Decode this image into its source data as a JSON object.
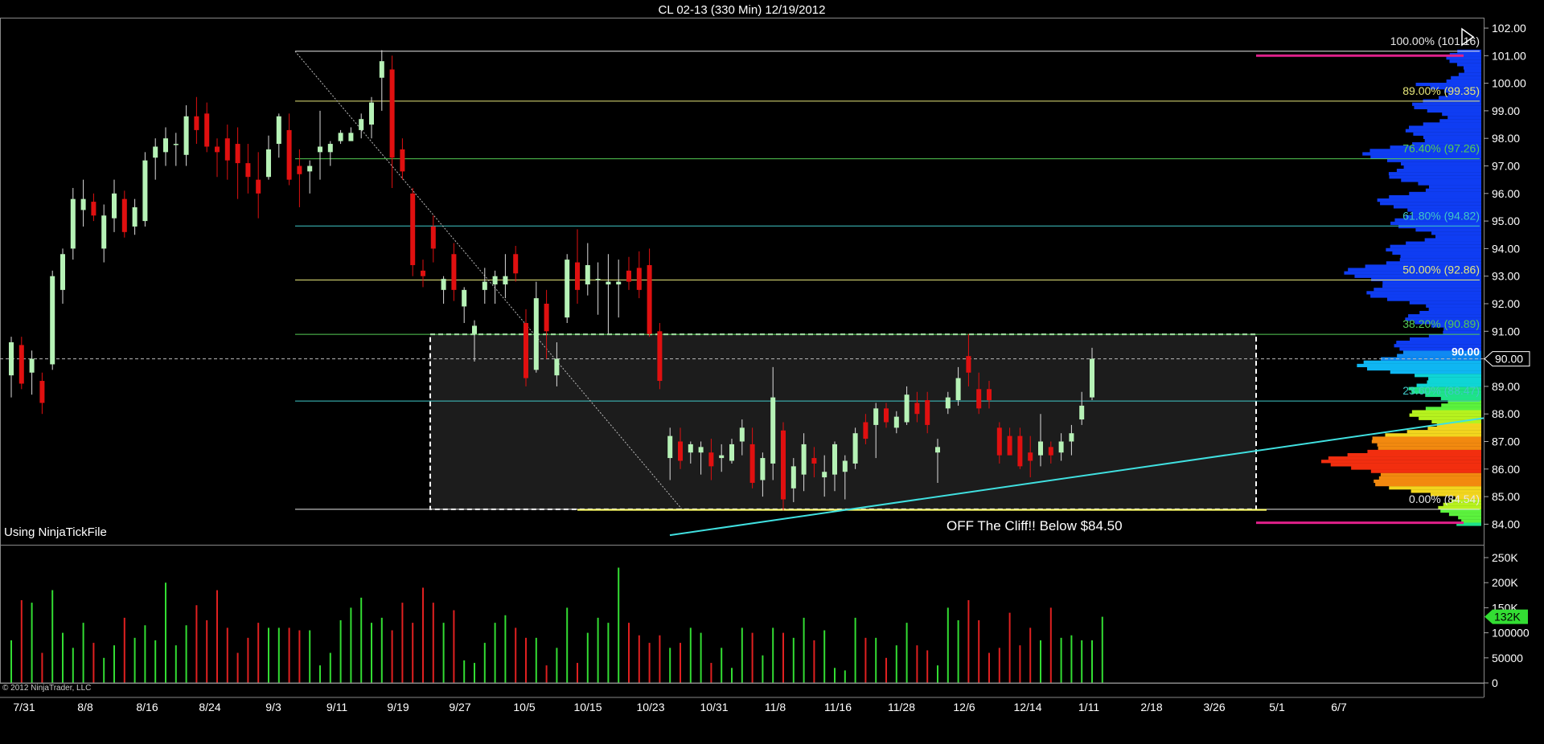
{
  "window": {
    "title": "CL 02-13 (330 Min)  12/19/2012",
    "watermark": "Using NinjaTickFile",
    "copyright": "© 2012 NinjaTrader, LLC"
  },
  "annotation": "OFF The Cliff!! Below $84.50",
  "price_marker": {
    "label": "90.00",
    "value": 90.0
  },
  "volume_marker": {
    "label": "132K",
    "value": 132000
  },
  "colors": {
    "background": "#000000",
    "up_candle": "#b6f2b6",
    "down_candle": "#e01010",
    "up_volume": "#33dd33",
    "down_volume": "#e02020",
    "fib_yellow": "#e6e67a",
    "fib_green": "#55cc55",
    "fib_cyan": "#40c8c8",
    "trendline": "#40e0e0",
    "box_fill": "#1c1c1c",
    "support_line": "#ffff66",
    "profile_magenta": "#e0208a"
  },
  "chart_data": [
    {
      "type": "candlestick",
      "title": "CL 02-13 (330 Min)  12/19/2012",
      "ylim": [
        83.6,
        102.0
      ],
      "y_ticks": [
        84.0,
        85.0,
        86.0,
        87.0,
        88.0,
        89.0,
        90.0,
        91.0,
        92.0,
        93.0,
        94.0,
        95.0,
        96.0,
        97.0,
        98.0,
        99.0,
        100.0,
        101.0,
        102.0
      ],
      "x_ticks": [
        "7/31",
        "8/8",
        "8/16",
        "8/24",
        "9/3",
        "9/11",
        "9/19",
        "9/27",
        "10/5",
        "10/15",
        "10/23",
        "10/31",
        "11/8",
        "11/16",
        "11/28",
        "12/6",
        "12/14",
        "1/11",
        "2/18",
        "3/26",
        "5/1",
        "6/7"
      ],
      "candles": [
        {
          "o": 89.4,
          "h": 90.8,
          "l": 88.6,
          "c": 90.6
        },
        {
          "o": 90.5,
          "h": 90.8,
          "l": 88.9,
          "c": 89.1
        },
        {
          "o": 89.5,
          "h": 90.3,
          "l": 88.7,
          "c": 90.0
        },
        {
          "o": 89.2,
          "h": 89.5,
          "l": 88.0,
          "c": 88.4
        },
        {
          "o": 89.8,
          "h": 93.2,
          "l": 89.6,
          "c": 93.0
        },
        {
          "o": 92.5,
          "h": 94.0,
          "l": 92.0,
          "c": 93.8
        },
        {
          "o": 94.0,
          "h": 96.2,
          "l": 93.6,
          "c": 95.8
        },
        {
          "o": 95.4,
          "h": 96.5,
          "l": 94.8,
          "c": 95.8
        },
        {
          "o": 95.7,
          "h": 96.0,
          "l": 95.0,
          "c": 95.2
        },
        {
          "o": 94.0,
          "h": 95.6,
          "l": 93.5,
          "c": 95.2
        },
        {
          "o": 95.1,
          "h": 96.5,
          "l": 94.6,
          "c": 96.0
        },
        {
          "o": 95.8,
          "h": 96.1,
          "l": 94.4,
          "c": 94.6
        },
        {
          "o": 94.8,
          "h": 95.8,
          "l": 94.5,
          "c": 95.5
        },
        {
          "o": 95.0,
          "h": 97.5,
          "l": 94.8,
          "c": 97.2
        },
        {
          "o": 97.3,
          "h": 98.0,
          "l": 96.5,
          "c": 97.7
        },
        {
          "o": 97.5,
          "h": 98.4,
          "l": 97.0,
          "c": 98.0
        },
        {
          "o": 97.8,
          "h": 98.2,
          "l": 97.0,
          "c": 97.8
        },
        {
          "o": 97.4,
          "h": 99.2,
          "l": 97.0,
          "c": 98.8
        },
        {
          "o": 98.8,
          "h": 99.5,
          "l": 97.8,
          "c": 98.3
        },
        {
          "o": 98.9,
          "h": 99.3,
          "l": 97.5,
          "c": 97.7
        },
        {
          "o": 97.7,
          "h": 98.0,
          "l": 96.6,
          "c": 97.5
        },
        {
          "o": 98.0,
          "h": 98.5,
          "l": 96.5,
          "c": 97.2
        },
        {
          "o": 97.8,
          "h": 98.4,
          "l": 95.8,
          "c": 97.1
        },
        {
          "o": 97.1,
          "h": 97.8,
          "l": 96.0,
          "c": 96.6
        },
        {
          "o": 96.5,
          "h": 97.5,
          "l": 95.1,
          "c": 96.0
        },
        {
          "o": 96.6,
          "h": 98.1,
          "l": 96.5,
          "c": 97.6
        },
        {
          "o": 97.8,
          "h": 98.9,
          "l": 97.3,
          "c": 98.8
        },
        {
          "o": 98.3,
          "h": 98.9,
          "l": 96.3,
          "c": 96.5
        },
        {
          "o": 97.0,
          "h": 97.6,
          "l": 95.5,
          "c": 96.7
        },
        {
          "o": 96.8,
          "h": 97.2,
          "l": 96.0,
          "c": 97.0
        },
        {
          "o": 97.5,
          "h": 99.0,
          "l": 96.5,
          "c": 97.7
        },
        {
          "o": 97.5,
          "h": 97.9,
          "l": 97.0,
          "c": 97.8
        },
        {
          "o": 97.9,
          "h": 98.3,
          "l": 97.8,
          "c": 98.2
        },
        {
          "o": 97.9,
          "h": 98.4,
          "l": 98.0,
          "c": 98.2
        },
        {
          "o": 98.3,
          "h": 98.9,
          "l": 98.0,
          "c": 98.7
        },
        {
          "o": 98.5,
          "h": 99.5,
          "l": 98.0,
          "c": 99.3
        },
        {
          "o": 100.2,
          "h": 101.2,
          "l": 99.0,
          "c": 100.8
        },
        {
          "o": 100.5,
          "h": 101.0,
          "l": 96.2,
          "c": 97.3
        },
        {
          "o": 97.6,
          "h": 98.0,
          "l": 96.5,
          "c": 96.8
        },
        {
          "o": 96.0,
          "h": 96.2,
          "l": 93.0,
          "c": 93.4
        },
        {
          "o": 93.2,
          "h": 93.6,
          "l": 92.6,
          "c": 93.0
        },
        {
          "o": 94.8,
          "h": 95.2,
          "l": 93.5,
          "c": 94.0
        },
        {
          "o": 92.5,
          "h": 93.0,
          "l": 92.0,
          "c": 92.9
        },
        {
          "o": 93.8,
          "h": 94.2,
          "l": 92.1,
          "c": 92.5
        },
        {
          "o": 91.9,
          "h": 92.6,
          "l": 91.3,
          "c": 92.5
        },
        {
          "o": 90.9,
          "h": 91.4,
          "l": 89.9,
          "c": 91.2
        },
        {
          "o": 92.5,
          "h": 93.3,
          "l": 92.0,
          "c": 92.8
        },
        {
          "o": 92.7,
          "h": 93.2,
          "l": 92.0,
          "c": 93.0
        },
        {
          "o": 92.7,
          "h": 93.8,
          "l": 92.2,
          "c": 93.0
        },
        {
          "o": 93.8,
          "h": 94.1,
          "l": 92.8,
          "c": 93.1
        },
        {
          "o": 91.3,
          "h": 91.8,
          "l": 89.0,
          "c": 89.3
        },
        {
          "o": 89.6,
          "h": 92.8,
          "l": 89.5,
          "c": 92.2
        },
        {
          "o": 92.0,
          "h": 92.5,
          "l": 90.0,
          "c": 91.0
        },
        {
          "o": 89.4,
          "h": 90.6,
          "l": 89.0,
          "c": 90.0
        },
        {
          "o": 91.5,
          "h": 93.8,
          "l": 91.3,
          "c": 93.6
        },
        {
          "o": 93.5,
          "h": 94.7,
          "l": 92.0,
          "c": 92.5
        },
        {
          "o": 92.7,
          "h": 94.2,
          "l": 92.3,
          "c": 93.4
        },
        {
          "o": 92.9,
          "h": 93.5,
          "l": 91.6,
          "c": 92.9
        },
        {
          "o": 92.7,
          "h": 93.8,
          "l": 90.9,
          "c": 92.8
        },
        {
          "o": 92.7,
          "h": 93.6,
          "l": 91.5,
          "c": 92.8
        },
        {
          "o": 93.2,
          "h": 93.7,
          "l": 92.5,
          "c": 92.8
        },
        {
          "o": 93.3,
          "h": 93.9,
          "l": 92.2,
          "c": 92.5
        },
        {
          "o": 93.4,
          "h": 94.0,
          "l": 90.8,
          "c": 90.9
        },
        {
          "o": 91.0,
          "h": 91.3,
          "l": 88.9,
          "c": 89.2
        },
        {
          "o": 86.4,
          "h": 87.5,
          "l": 85.6,
          "c": 87.2
        },
        {
          "o": 87.0,
          "h": 87.5,
          "l": 86.0,
          "c": 86.3
        },
        {
          "o": 86.6,
          "h": 87.0,
          "l": 86.2,
          "c": 86.9
        },
        {
          "o": 86.6,
          "h": 87.0,
          "l": 85.8,
          "c": 86.8
        },
        {
          "o": 86.6,
          "h": 87.1,
          "l": 85.6,
          "c": 86.1
        },
        {
          "o": 86.4,
          "h": 86.9,
          "l": 85.9,
          "c": 86.5
        },
        {
          "o": 86.3,
          "h": 87.1,
          "l": 86.2,
          "c": 86.9
        },
        {
          "o": 87.0,
          "h": 87.8,
          "l": 86.5,
          "c": 87.5
        },
        {
          "o": 86.9,
          "h": 87.5,
          "l": 85.3,
          "c": 85.5
        },
        {
          "o": 85.6,
          "h": 86.6,
          "l": 85.0,
          "c": 86.4
        },
        {
          "o": 86.2,
          "h": 89.7,
          "l": 85.6,
          "c": 88.6
        },
        {
          "o": 87.4,
          "h": 87.7,
          "l": 84.5,
          "c": 84.9
        },
        {
          "o": 85.3,
          "h": 86.4,
          "l": 84.8,
          "c": 86.1
        },
        {
          "o": 85.8,
          "h": 87.3,
          "l": 85.2,
          "c": 86.9
        },
        {
          "o": 86.4,
          "h": 86.8,
          "l": 85.7,
          "c": 86.2
        },
        {
          "o": 85.7,
          "h": 86.5,
          "l": 85.0,
          "c": 85.9
        },
        {
          "o": 85.8,
          "h": 87.0,
          "l": 85.2,
          "c": 86.9
        },
        {
          "o": 85.9,
          "h": 86.5,
          "l": 84.9,
          "c": 86.3
        },
        {
          "o": 86.2,
          "h": 87.5,
          "l": 86.0,
          "c": 87.3
        },
        {
          "o": 87.7,
          "h": 88.0,
          "l": 86.9,
          "c": 87.1
        },
        {
          "o": 87.6,
          "h": 88.4,
          "l": 86.4,
          "c": 88.2
        },
        {
          "o": 88.2,
          "h": 88.4,
          "l": 87.5,
          "c": 87.7
        },
        {
          "o": 87.5,
          "h": 88.1,
          "l": 87.3,
          "c": 87.9
        },
        {
          "o": 87.7,
          "h": 89.0,
          "l": 87.6,
          "c": 88.7
        },
        {
          "o": 88.4,
          "h": 88.8,
          "l": 87.7,
          "c": 88.0
        },
        {
          "o": 88.5,
          "h": 88.8,
          "l": 87.3,
          "c": 87.6
        },
        {
          "o": 86.6,
          "h": 87.1,
          "l": 85.5,
          "c": 86.8
        },
        {
          "o": 88.2,
          "h": 88.8,
          "l": 88.0,
          "c": 88.6
        },
        {
          "o": 88.5,
          "h": 89.7,
          "l": 88.3,
          "c": 89.3
        },
        {
          "o": 90.1,
          "h": 90.9,
          "l": 89.0,
          "c": 89.5
        },
        {
          "o": 88.9,
          "h": 89.5,
          "l": 88.0,
          "c": 88.2
        },
        {
          "o": 88.9,
          "h": 89.2,
          "l": 88.2,
          "c": 88.5
        },
        {
          "o": 87.5,
          "h": 87.7,
          "l": 86.2,
          "c": 86.5
        },
        {
          "o": 87.2,
          "h": 87.5,
          "l": 86.5,
          "c": 86.5
        },
        {
          "o": 87.2,
          "h": 87.5,
          "l": 86.0,
          "c": 86.1
        },
        {
          "o": 86.6,
          "h": 87.2,
          "l": 85.7,
          "c": 86.3
        },
        {
          "o": 86.5,
          "h": 88.0,
          "l": 86.1,
          "c": 87.0
        },
        {
          "o": 86.8,
          "h": 87.0,
          "l": 86.2,
          "c": 86.5
        },
        {
          "o": 86.6,
          "h": 87.3,
          "l": 86.3,
          "c": 87.0
        },
        {
          "o": 87.0,
          "h": 87.6,
          "l": 86.5,
          "c": 87.3
        },
        {
          "o": 87.8,
          "h": 88.8,
          "l": 87.6,
          "c": 88.3
        },
        {
          "o": 88.6,
          "h": 90.4,
          "l": 88.5,
          "c": 90.0
        }
      ],
      "fib_levels": [
        {
          "label": "100.00% (101.16)",
          "value": 101.16,
          "color": "#e8e8e8"
        },
        {
          "label": "89.00% (99.35)",
          "value": 99.35,
          "color": "#e6e67a"
        },
        {
          "label": "76.40% (97.26)",
          "value": 97.26,
          "color": "#55cc55"
        },
        {
          "label": "61.80% (94.82)",
          "value": 94.82,
          "color": "#40c8c8"
        },
        {
          "label": "50.00% (92.86)",
          "value": 92.86,
          "color": "#e6e67a"
        },
        {
          "label": "38.20% (90.89)",
          "value": 90.89,
          "color": "#55cc55"
        },
        {
          "label": "23.60% (88.47)",
          "value": 88.47,
          "color": "#40c8c8"
        },
        {
          "label": "0.00% (84.54)",
          "value": 84.54,
          "color": "#e8e8e8"
        }
      ]
    },
    {
      "type": "bar",
      "ylim": [
        0,
        260000
      ],
      "y_ticks": [
        {
          "label": "0",
          "value": 0
        },
        {
          "label": "50000",
          "value": 50000
        },
        {
          "label": "100000",
          "value": 100000
        },
        {
          "label": "150K",
          "value": 150000
        },
        {
          "label": "200K",
          "value": 200000
        },
        {
          "label": "250K",
          "value": 250000
        }
      ],
      "values": [
        85000,
        165000,
        160000,
        60000,
        185000,
        100000,
        70000,
        120000,
        80000,
        50000,
        75000,
        130000,
        90000,
        115000,
        85000,
        200000,
        75000,
        115000,
        155000,
        125000,
        185000,
        110000,
        60000,
        90000,
        120000,
        110000,
        110000,
        110000,
        105000,
        105000,
        35000,
        60000,
        125000,
        150000,
        170000,
        120000,
        130000,
        105000,
        160000,
        120000,
        190000,
        160000,
        120000,
        145000,
        45000,
        40000,
        80000,
        120000,
        135000,
        110000,
        90000,
        90000,
        35000,
        70000,
        150000,
        40000,
        100000,
        130000,
        120000,
        230000,
        120000,
        95000,
        80000,
        95000,
        70000,
        80000,
        110000,
        100000,
        40000,
        70000,
        30000,
        110000,
        100000,
        55000,
        110000,
        100000,
        90000,
        130000,
        85000,
        105000,
        30000,
        25000,
        130000,
        90000,
        90000,
        50000,
        75000,
        120000,
        75000,
        65000,
        35000,
        150000,
        125000,
        165000,
        125000,
        60000,
        70000,
        140000,
        75000,
        110000,
        85000,
        150000,
        90000,
        95000,
        85000,
        85000,
        132000
      ]
    }
  ]
}
